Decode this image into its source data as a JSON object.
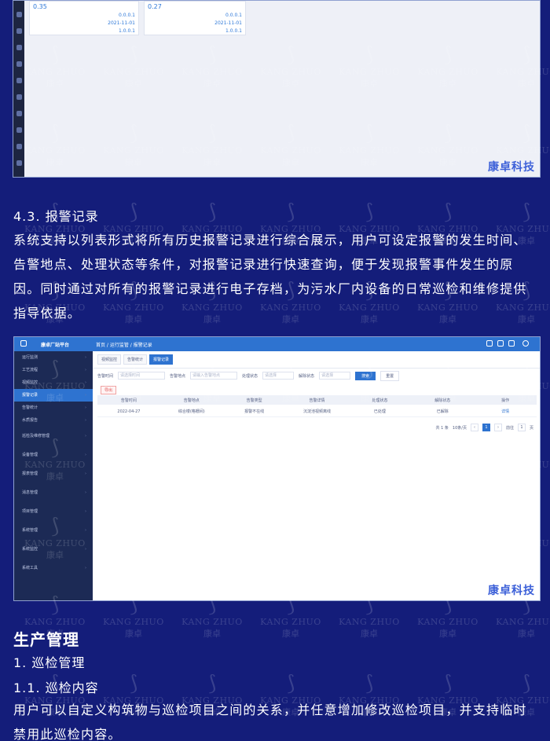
{
  "screenshot1": {
    "cards": [
      {
        "big": "0.35",
        "rows": [
          [
            "",
            "0.0.0.1"
          ],
          [
            "",
            "2021-11-01"
          ],
          [
            "",
            "1.0.0.1"
          ]
        ]
      },
      {
        "big": "0.27",
        "rows": [
          [
            "",
            "0.0.0.1"
          ],
          [
            "",
            "2021-11-01"
          ],
          [
            "",
            "1.0.0.1"
          ]
        ]
      }
    ],
    "brand": "康卓科技"
  },
  "section_4_3": {
    "heading": "4.3. 报警记录",
    "paragraph": "系统支持以列表形式将所有历史报警记录进行综合展示，用户可设定报警的发生时间、告警地点、处理状态等条件，对报警记录进行快速查询，便于发现报警事件发生的原因。同时通过对所有的报警记录进行电子存档，为污水厂内设备的日常巡检和维修提供指导依据。"
  },
  "screenshot2": {
    "app_title": "康卓厂站平台",
    "breadcrumb": "首页 / 运行监管 / 报警记录",
    "sidebar": [
      "运行监测",
      "工艺流程",
      "视频监控",
      "报警记录",
      "告警统计",
      "水质报告",
      "巡检及维修管理",
      "设备管理",
      "报表管理",
      "消息管理",
      "项目管理",
      "系统管理",
      "系统监控",
      "系统工具"
    ],
    "tabs": [
      "视频监控",
      "告警统计",
      "报警记录"
    ],
    "filters": [
      {
        "label": "告警时间",
        "placeholder": "请选择时间"
      },
      {
        "label": "告警地点",
        "placeholder": "请输入告警地点"
      },
      {
        "label": "处理状态",
        "placeholder": "请选择"
      },
      {
        "label": "解除状态",
        "placeholder": "请选择"
      }
    ],
    "search_button": "搜索",
    "reset_button": "重置",
    "export_button": "导出",
    "columns": [
      "告警时间",
      "告警地点",
      "告警类型",
      "告警详情",
      "处理状态",
      "解除状态",
      "操作"
    ],
    "rows": [
      [
        "2022-04-27",
        "综合楼(格栅间)",
        "报警不在线",
        "沉淀池视频离线",
        "已处理",
        "已解除",
        "详情"
      ]
    ],
    "pager": {
      "total": "共 1 条",
      "size": "10条/页",
      "pages": [
        "1"
      ],
      "goto": "前往",
      "page_input": "1",
      "page_suffix": "页"
    },
    "brand": "康卓科技"
  },
  "production": {
    "title": "生产管理",
    "item1": "1. 巡检管理",
    "item1_1": "1.1. 巡检内容",
    "paragraph": "用户可以自定义构筑物与巡检项目之间的关系，并任意增加修改巡检项目，并支持临时禁用此巡检内容。"
  },
  "watermark": {
    "en": "KANG ZHUO",
    "cn": "康卓"
  }
}
